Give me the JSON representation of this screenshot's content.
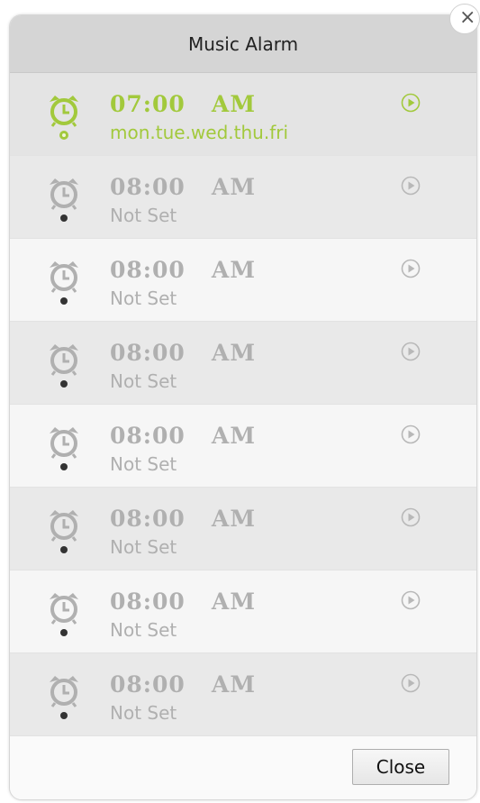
{
  "dialog": {
    "title": "Music Alarm",
    "close_x": "×",
    "close_label": "Close"
  },
  "colors": {
    "active": "#a2c93c",
    "inactive": "#b0b0b0"
  },
  "alarms": [
    {
      "time": "07:00",
      "ampm": "AM",
      "days": "mon.tue.wed.thu.fri",
      "active": true,
      "icon": "alarm-clock-icon"
    },
    {
      "time": "08:00",
      "ampm": "AM",
      "days": "Not Set",
      "active": false,
      "icon": "alarm-clock-icon"
    },
    {
      "time": "08:00",
      "ampm": "AM",
      "days": "Not Set",
      "active": false,
      "icon": "alarm-clock-icon"
    },
    {
      "time": "08:00",
      "ampm": "AM",
      "days": "Not Set",
      "active": false,
      "icon": "alarm-clock-icon"
    },
    {
      "time": "08:00",
      "ampm": "AM",
      "days": "Not Set",
      "active": false,
      "icon": "alarm-clock-icon"
    },
    {
      "time": "08:00",
      "ampm": "AM",
      "days": "Not Set",
      "active": false,
      "icon": "alarm-clock-icon"
    },
    {
      "time": "08:00",
      "ampm": "AM",
      "days": "Not Set",
      "active": false,
      "icon": "alarm-clock-icon"
    },
    {
      "time": "08:00",
      "ampm": "AM",
      "days": "Not Set",
      "active": false,
      "icon": "alarm-clock-icon"
    }
  ]
}
